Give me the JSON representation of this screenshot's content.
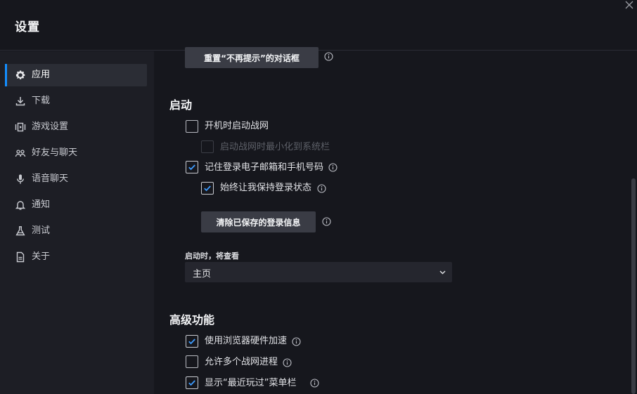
{
  "window": {
    "title": "设置"
  },
  "sidebar": {
    "items": [
      {
        "label": "应用",
        "icon": "gear-icon",
        "active": true
      },
      {
        "label": "下载",
        "icon": "download-icon"
      },
      {
        "label": "游戏设置",
        "icon": "game-settings-icon"
      },
      {
        "label": "好友与聊天",
        "icon": "friends-icon"
      },
      {
        "label": "语音聊天",
        "icon": "microphone-icon"
      },
      {
        "label": "通知",
        "icon": "bell-icon"
      },
      {
        "label": "测试",
        "icon": "flask-icon"
      },
      {
        "label": "关于",
        "icon": "document-icon"
      }
    ]
  },
  "main": {
    "reset_dialogs_button": "重置“不再提示”的对话框",
    "startup": {
      "title": "启动",
      "launch_on_startup": {
        "label": "开机时启动战网",
        "checked": false
      },
      "minimize_to_tray": {
        "label": "启动战网时最小化到系统栏",
        "checked": false,
        "disabled": true
      },
      "remember_login": {
        "label": "记住登录电子邮箱和手机号码",
        "checked": true
      },
      "keep_logged_in": {
        "label": "始终让我保持登录状态",
        "checked": true
      },
      "clear_login_button": "清除已保存的登录信息",
      "startup_view_label": "启动时，将查看",
      "startup_view_value": "主页"
    },
    "advanced": {
      "title": "高级功能",
      "hw_acceleration": {
        "label": "使用浏览器硬件加速",
        "checked": true
      },
      "multiple_instances": {
        "label": "允许多个战网进程",
        "checked": false
      },
      "recently_played": {
        "label": "显示“最近玩过”菜单栏",
        "checked": true
      }
    }
  },
  "colors": {
    "background": "#16171d",
    "sidebar": "#1d1e25",
    "accent": "#148eff",
    "button": "#3a3c45"
  }
}
